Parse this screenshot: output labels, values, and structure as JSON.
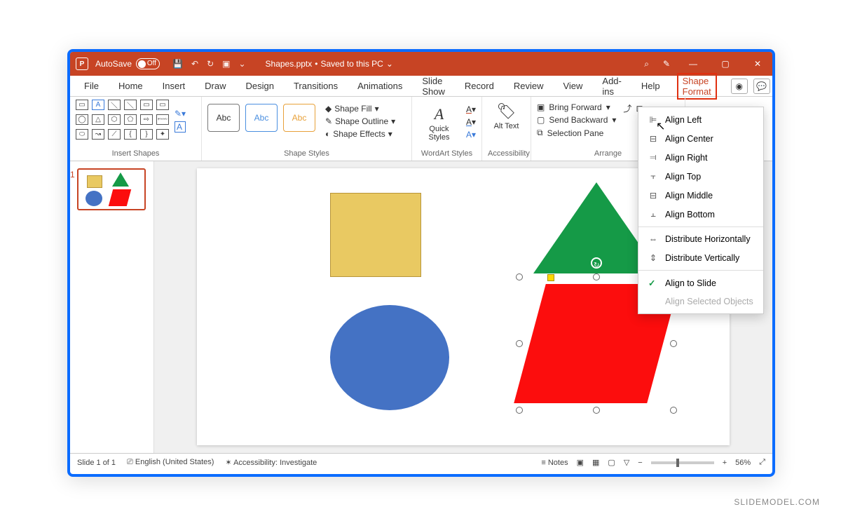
{
  "titlebar": {
    "autosave_label": "AutoSave",
    "autosave_state": "Off",
    "filename": "Shapes.pptx",
    "saved_status": "Saved to this PC"
  },
  "tabs": [
    "File",
    "Home",
    "Insert",
    "Draw",
    "Design",
    "Transitions",
    "Animations",
    "Slide Show",
    "Record",
    "Review",
    "View",
    "Add-ins",
    "Help",
    "Shape Format"
  ],
  "ribbon": {
    "insert_shapes": "Insert Shapes",
    "shape_styles": "Shape Styles",
    "wordart_styles": "WordArt Styles",
    "accessibility_group": "Accessibility",
    "arrange": "Arrange",
    "abc": "Abc",
    "shape_fill": "Shape Fill",
    "shape_outline": "Shape Outline",
    "shape_effects": "Shape Effects",
    "quick_styles": "Quick Styles",
    "alt_text": "Alt Text",
    "bring_forward": "Bring Forward",
    "send_backward": "Send Backward",
    "selection_pane": "Selection Pane"
  },
  "align_menu": {
    "left": "Align Left",
    "center": "Align Center",
    "right": "Align Right",
    "top": "Align Top",
    "middle": "Align Middle",
    "bottom": "Align Bottom",
    "dist_h": "Distribute Horizontally",
    "dist_v": "Distribute Vertically",
    "to_slide": "Align to Slide",
    "selected": "Align Selected Objects"
  },
  "thumbnail_number": "1",
  "status": {
    "slide": "Slide 1 of 1",
    "language": "English (United States)",
    "accessibility": "Accessibility: Investigate",
    "notes": "Notes",
    "zoom": "56%"
  },
  "watermark": "SLIDEMODEL.COM"
}
